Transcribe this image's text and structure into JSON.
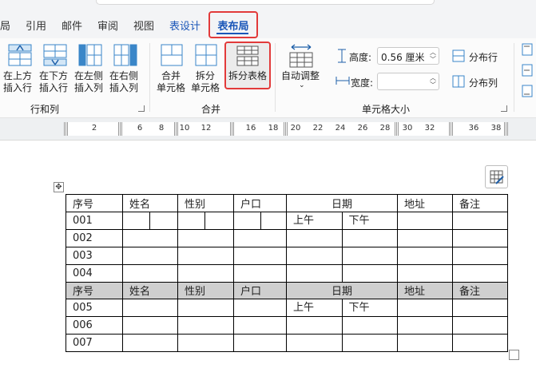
{
  "tabs": [
    {
      "label": "局",
      "active": false,
      "color": "#333333"
    },
    {
      "label": "引用",
      "active": false,
      "color": "#333333"
    },
    {
      "label": "邮件",
      "active": false,
      "color": "#333333"
    },
    {
      "label": "审阅",
      "active": false,
      "color": "#333333"
    },
    {
      "label": "视图",
      "active": false,
      "color": "#333333"
    },
    {
      "label": "表设计",
      "active": false,
      "color": "#1a56b8"
    },
    {
      "label": "表布局",
      "active": true,
      "color": "#1a56b8"
    }
  ],
  "ribbon": {
    "rows_cols": {
      "group_label": "行和列",
      "buttons": [
        {
          "line1": "在上方",
          "line2": "插入行",
          "icon": "insert-row-above-icon"
        },
        {
          "line1": "在下方",
          "line2": "插入行",
          "icon": "insert-row-below-icon"
        },
        {
          "line1": "在左侧",
          "line2": "插入列",
          "icon": "insert-col-left-icon"
        },
        {
          "line1": "在右侧",
          "line2": "插入列",
          "icon": "insert-col-right-icon"
        }
      ]
    },
    "merge": {
      "group_label": "合并",
      "buttons": [
        {
          "line1": "合并",
          "line2": "单元格",
          "icon": "merge-cells-icon"
        },
        {
          "line1": "拆分",
          "line2": "单元格",
          "icon": "split-cells-icon"
        },
        {
          "line1": "拆分表格",
          "line2": "",
          "icon": "split-table-icon",
          "highlighted": true
        }
      ]
    },
    "cell_size": {
      "group_label": "单元格大小",
      "autofit_label": "自动调整",
      "height_label": "高度:",
      "height_value": "0.56 厘米",
      "width_label": "宽度:",
      "width_value": "",
      "distribute_rows": "分布行",
      "distribute_cols": "分布列"
    }
  },
  "ruler": {
    "numbers": [
      "2",
      "6",
      "8",
      "10",
      "12",
      "16",
      "18",
      "20",
      "22",
      "24",
      "26",
      "28",
      "30",
      "32",
      "36",
      "38"
    ]
  },
  "table": {
    "header": [
      "序号",
      "姓名",
      "性别",
      "户口",
      "日期",
      "地址",
      "备注"
    ],
    "date_sub": [
      "上午",
      "下午"
    ],
    "rows_top": [
      "001",
      "002",
      "003",
      "004"
    ],
    "rows_bottom": [
      "005",
      "006",
      "007"
    ]
  },
  "colors": {
    "accent": "#1a56b8",
    "highlight_border": "#e23a3a",
    "repeat_header_bg": "#cfcfcf"
  }
}
